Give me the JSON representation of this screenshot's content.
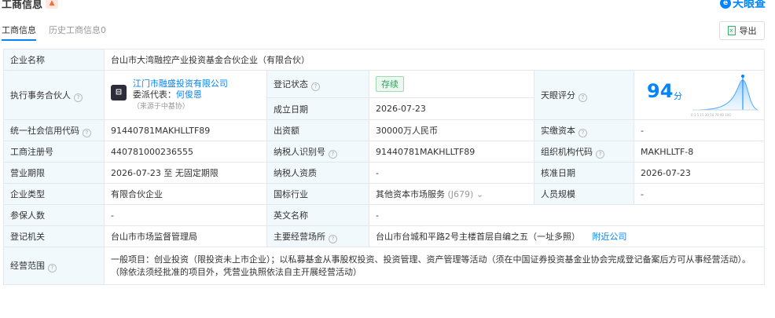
{
  "header": {
    "title": "工商信息",
    "logo_text": "天眼查"
  },
  "tabs": [
    {
      "label": "工商信息"
    },
    {
      "label": "历史工商信息0"
    }
  ],
  "export_label": "导出",
  "rows": {
    "company_name_label": "企业名称",
    "company_name": "台山市大湾融控产业投资基金合伙企业（有限合伙）",
    "partner_label": "执行事务合伙人",
    "partner_name": "江门市融盛投资有限公司",
    "partner_rep_prefix": "委派代表：",
    "partner_rep": "何俊恩",
    "partner_rep_note": "（来源于中基协）",
    "reg_status_label": "登记状态",
    "reg_status": "存续",
    "found_date_label": "成立日期",
    "found_date": "2026-07-23",
    "score_label": "天眼评分",
    "score": "94",
    "score_unit": "分",
    "credit_code_label": "统一社会信用代码",
    "credit_code": "91440781MAKHLLTF89",
    "capital_label": "出资额",
    "capital": "30000万人民币",
    "paid_label": "实缴资本",
    "paid": "-",
    "reg_no_label": "工商注册号",
    "reg_no": "440781000236555",
    "tax_label": "纳税人识别号",
    "tax_no": "91440781MAKHLLTF89",
    "org_code_label": "组织机构代码",
    "org_code": "MAKHLLTF-8",
    "term_label": "营业期限",
    "term": "2026-07-23 至 无固定期限",
    "taxpayer_label": "纳税人资质",
    "taxpayer": "-",
    "approve_label": "核准日期",
    "approve_date": "2026-07-23",
    "type_label": "企业类型",
    "type": "有限合伙企业",
    "industry_label": "国标行业",
    "industry": "其他资本市场服务",
    "industry_code": "(J679)",
    "staff_label": "人员规模",
    "staff": "-",
    "insured_label": "参保人数",
    "insured": "-",
    "en_name_label": "英文名称",
    "en_name": "-",
    "authority_label": "登记机关",
    "authority": "台山市市场监督管理局",
    "address_label": "主要经营场所",
    "address": "台山市台城和平路2号主楼首层自编之五（一址多照）",
    "nearby_label": "附近公司",
    "scope_label": "经营范围",
    "scope": "一般项目：创业投资（限投资未上市企业）；以私募基金从事股权投资、投资管理、资产管理等活动（须在中国证券投资基金业协会完成登记备案后方可从事经营活动）。（除依法须经批准的项目外，凭营业执照依法自主开展经营活动）"
  },
  "colors": {
    "accent": "#0084ff",
    "label_bg": "#f2f9fc",
    "status_green": "#24a75a"
  }
}
